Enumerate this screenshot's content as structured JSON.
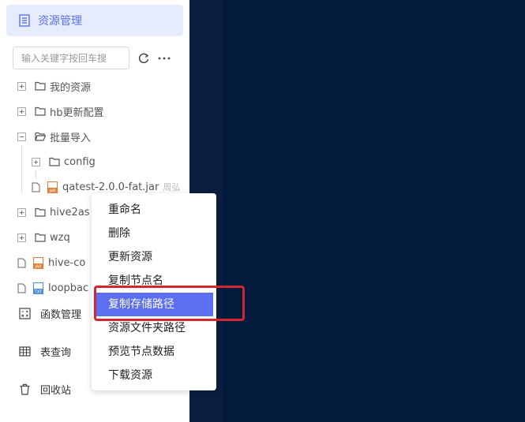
{
  "sidebar": {
    "header": {
      "label": "资源管理",
      "icon": "resource-icon"
    },
    "search": {
      "placeholder": "输入关键字按回车搜"
    },
    "tree": [
      {
        "label": "我的资源",
        "type": "folder",
        "state": "collapsed"
      },
      {
        "label": "hb更新配置",
        "type": "folder",
        "state": "collapsed"
      },
      {
        "label": "批量导入",
        "type": "folder",
        "state": "expanded"
      },
      {
        "label": "config",
        "type": "folder",
        "state": "collapsed"
      },
      {
        "label": "qatest-2.0.0-fat.jar",
        "suffix": "周弘",
        "type": "jar"
      },
      {
        "label": "hive2as",
        "type": "folder",
        "state": "collapsed"
      },
      {
        "label": "wzq",
        "type": "folder",
        "state": "collapsed"
      },
      {
        "label": "hive-co",
        "type": "jar"
      },
      {
        "label": "loopbac",
        "type": "txt"
      }
    ],
    "bottom": [
      {
        "label": "函数管理",
        "icon": "function-icon"
      },
      {
        "label": "表查询",
        "icon": "table-icon"
      },
      {
        "label": "回收站",
        "icon": "trash-icon"
      }
    ]
  },
  "context_menu": {
    "items": [
      "重命名",
      "删除",
      "更新资源",
      "复制节点名",
      "复制存储路径",
      "资源文件夹路径",
      "预览节点数据",
      "下载资源"
    ],
    "active_index": 4
  },
  "colors": {
    "accent": "#5b6ff0",
    "highlight_border": "#d3262f",
    "background": "#021a3c"
  }
}
